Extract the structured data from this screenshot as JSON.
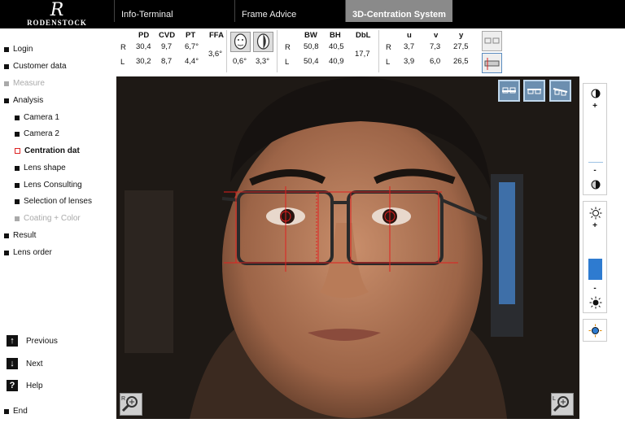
{
  "brand": {
    "mark": "R",
    "name": "RODENSTOCK"
  },
  "tabs": [
    {
      "label": "Info-Terminal"
    },
    {
      "label": "Frame Advice"
    },
    {
      "label": "3D-Centration System"
    }
  ],
  "nav": {
    "items": [
      {
        "label": "Login"
      },
      {
        "label": "Customer data"
      },
      {
        "label": "Measure"
      },
      {
        "label": "Analysis"
      },
      {
        "label": "Camera 1"
      },
      {
        "label": "Camera 2"
      },
      {
        "label": "Centration dat"
      },
      {
        "label": "Lens shape"
      },
      {
        "label": "Lens Consulting"
      },
      {
        "label": "Selection of lenses"
      },
      {
        "label": "Coating + Color"
      },
      {
        "label": "Result"
      },
      {
        "label": "Lens order"
      }
    ],
    "actions": {
      "previous": "Previous",
      "next": "Next",
      "help": "Help",
      "end": "End"
    },
    "icons": {
      "previous": "↑",
      "next": "↓",
      "help": "?"
    }
  },
  "measurements": {
    "headers": {
      "pd": "PD",
      "cvd": "CVD",
      "pt": "PT",
      "ffa": "FFA",
      "bw": "BW",
      "bh": "BH",
      "dbl": "DbL",
      "u": "u",
      "v": "v",
      "y": "y"
    },
    "row_labels": {
      "r": "R",
      "l": "L"
    },
    "right": {
      "pd": "30,4",
      "cvd": "9,7",
      "pt": "6,7°",
      "bw": "50,8",
      "bh": "40,5",
      "u": "3,7",
      "v": "7,3",
      "y": "27,5"
    },
    "left": {
      "pd": "30,2",
      "cvd": "8,7",
      "pt": "4,4°",
      "bw": "50,4",
      "bh": "40,9",
      "u": "3,9",
      "v": "6,0",
      "y": "26,5"
    },
    "ffa": "3,6°",
    "dbl": "17,7",
    "head_angles": {
      "a": "0,6°",
      "b": "3,3°"
    }
  },
  "camera": {
    "zoom_left_label": "R",
    "zoom_right_label": "L"
  },
  "controls": {
    "plus": "+",
    "minus": "-"
  },
  "colors": {
    "accent_blue": "#2e7bd0",
    "marker_red": "#e02020",
    "active_tab": "#8a8a8a"
  }
}
